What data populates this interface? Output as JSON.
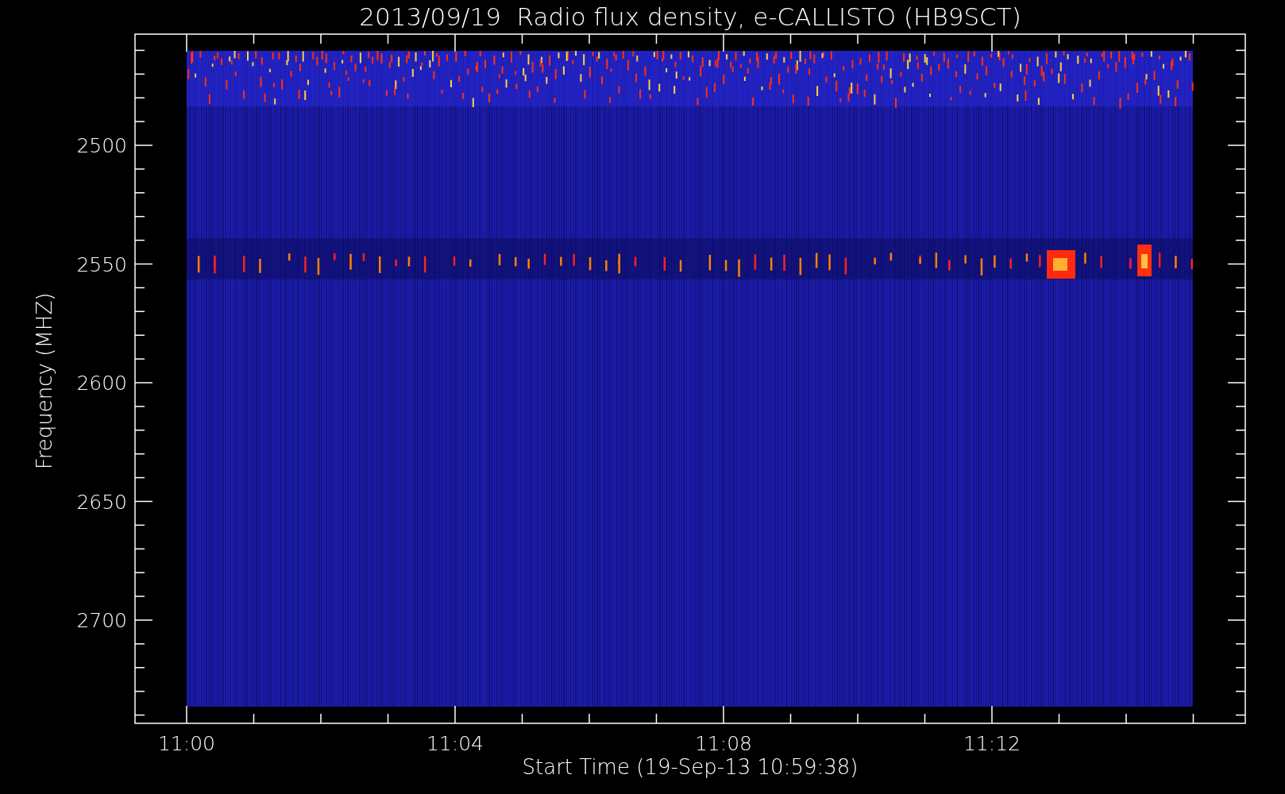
{
  "title": "2013/09/19  Radio flux density, e-CALLISTO (HB9SCT)",
  "plot": {
    "kind": "spectrogram",
    "ylabel": "Frequency (MHZ)",
    "xlabel": "Start Time (19-Sep-13 10:59:38)",
    "yticks": [
      "2500",
      "2550",
      "2600",
      "2650",
      "2700"
    ],
    "xticks": [
      "11:00",
      "11:04",
      "11:08",
      "11:12"
    ]
  }
}
